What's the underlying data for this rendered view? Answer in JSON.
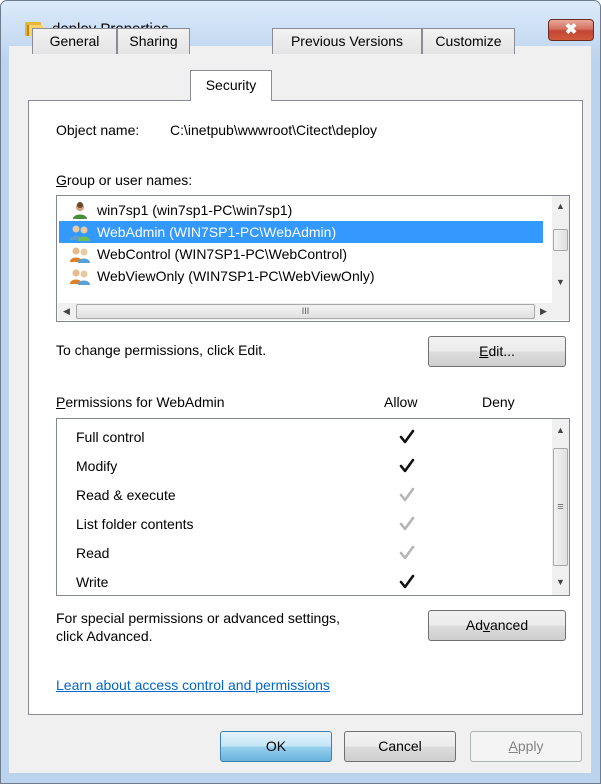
{
  "window": {
    "title": "deploy Properties",
    "close_label": "✖"
  },
  "tabs": [
    {
      "label": "General"
    },
    {
      "label": "Sharing"
    },
    {
      "label": "Security"
    },
    {
      "label": "Previous Versions"
    },
    {
      "label": "Customize"
    }
  ],
  "active_tab": "Security",
  "object": {
    "label": "Object name:",
    "value": "C:\\inetpub\\wwwroot\\Citect\\deploy"
  },
  "group_list": {
    "label": "Group or user names:",
    "items": [
      {
        "name": "win7sp1 (win7sp1-PC\\win7sp1)",
        "icon": "user-icon",
        "selected": false
      },
      {
        "name": "WebAdmin (WIN7SP1-PC\\WebAdmin)",
        "icon": "group-icon",
        "selected": true
      },
      {
        "name": "WebControl (WIN7SP1-PC\\WebControl)",
        "icon": "group-icon",
        "selected": false
      },
      {
        "name": "WebViewOnly (WIN7SP1-PC\\WebViewOnly)",
        "icon": "group-icon",
        "selected": false
      }
    ],
    "hscroll_grip": "III"
  },
  "edit": {
    "hint": "To change permissions, click Edit.",
    "button_label": "Edit..."
  },
  "permissions": {
    "label": "Permissions for WebAdmin",
    "allow_header": "Allow",
    "deny_header": "Deny",
    "scroll_grip": "≡",
    "rows": [
      {
        "name": "Full control",
        "allow": true,
        "inherited": false
      },
      {
        "name": "Modify",
        "allow": true,
        "inherited": false
      },
      {
        "name": "Read & execute",
        "allow": true,
        "inherited": true
      },
      {
        "name": "List folder contents",
        "allow": true,
        "inherited": true
      },
      {
        "name": "Read",
        "allow": true,
        "inherited": true
      },
      {
        "name": "Write",
        "allow": true,
        "inherited": false
      }
    ]
  },
  "advanced": {
    "hint_line1": "For special permissions or advanced settings,",
    "hint_line2": "click Advanced.",
    "button_label": "Advanced"
  },
  "learn_link": "Learn about access control and permissions",
  "footer": {
    "ok": "OK",
    "cancel": "Cancel",
    "apply": "Apply"
  },
  "colors": {
    "selection": "#3399ff",
    "link": "#0066cc",
    "close_button": "#c34532"
  }
}
